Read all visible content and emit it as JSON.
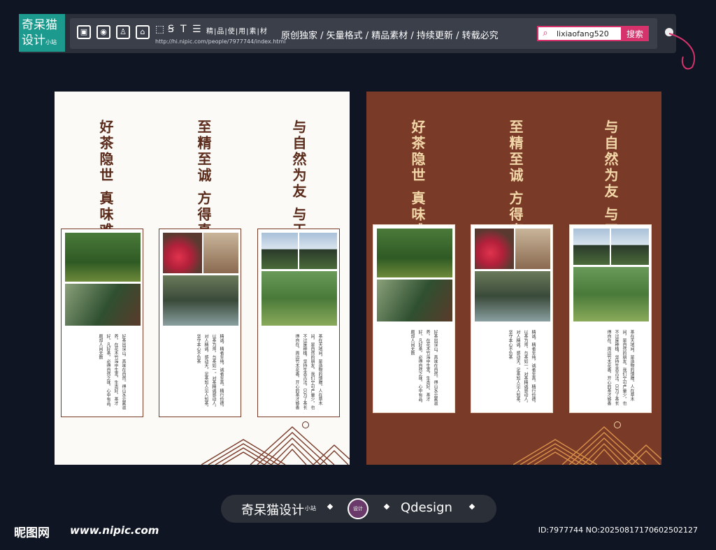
{
  "header": {
    "logo_text_1": "奇呆猫",
    "logo_text_2": "设计",
    "logo_small": "小站",
    "toolbar_label": "精|品|使|用|素|材",
    "url": "http://hi.nipic.com/people/7977744/index.html",
    "slogan": "原创独家 / 矢量格式 / 精品素材 / 持续更新 / 转载必究",
    "search_value": "lixiaofang520",
    "search_button": "搜索"
  },
  "posters": [
    {
      "theme": "light",
      "headings": [
        "好茶隐世 真味难得",
        "至精至诚 方得真味",
        "与自然为友 与天地对话"
      ],
      "texts": [
        "好茶出深山，真味在自然。得山水云雾滋养，在花木竹海中生发，生态好，茶才好。凡好茶，必得自然之味，心中有品，颇却人间无数",
        "精诚，精者至纯，诚者至真。精行俭德，以茶为师，与茶如一。对茶精诚感动人，对人精诚，感动天。足茶知人见人知茶，坚守本心不负茶",
        "茶在天地间，是造物的馈赠。人在草木间，是自然的朋友。我们宁可产量少，也不过度种植，坚持生态古法，只为了茶长得自在。周边竹木花香，开心的茶才够香"
      ]
    },
    {
      "theme": "dark",
      "headings": [
        "好茶隐世 真味难得",
        "至精至诚 方得真味",
        "与自然为友 与天地对话"
      ],
      "texts": [
        "好茶出深山，真味在自然。得山水云雾滋养，在花木竹海中生发，生态好，茶才好。凡好茶，必得自然之味，心中有品，颇却人间无数",
        "精诚，精者至纯，诚者至真。精行俭德，以茶为师，与茶如一。对茶精诚感动人，对人精诚，感动天。足茶知人见人知茶，坚守本心不负茶",
        "茶在天地间，是造物的馈赠。人在草木间，是自然的朋友。我们宁可产量少，也不过度种植，坚持生态古法，只为了茶长得自在。周边竹木花香，开心的茶才够香"
      ]
    }
  ],
  "footer": {
    "brand": "奇呆猫设计",
    "brand_small": "小站",
    "badge": "设计",
    "qdesign": "Qdesign",
    "site_logo": "昵图网",
    "site_url": "www.nipic.com",
    "id_text": "ID:7977744 NO:20250817170602502127"
  }
}
